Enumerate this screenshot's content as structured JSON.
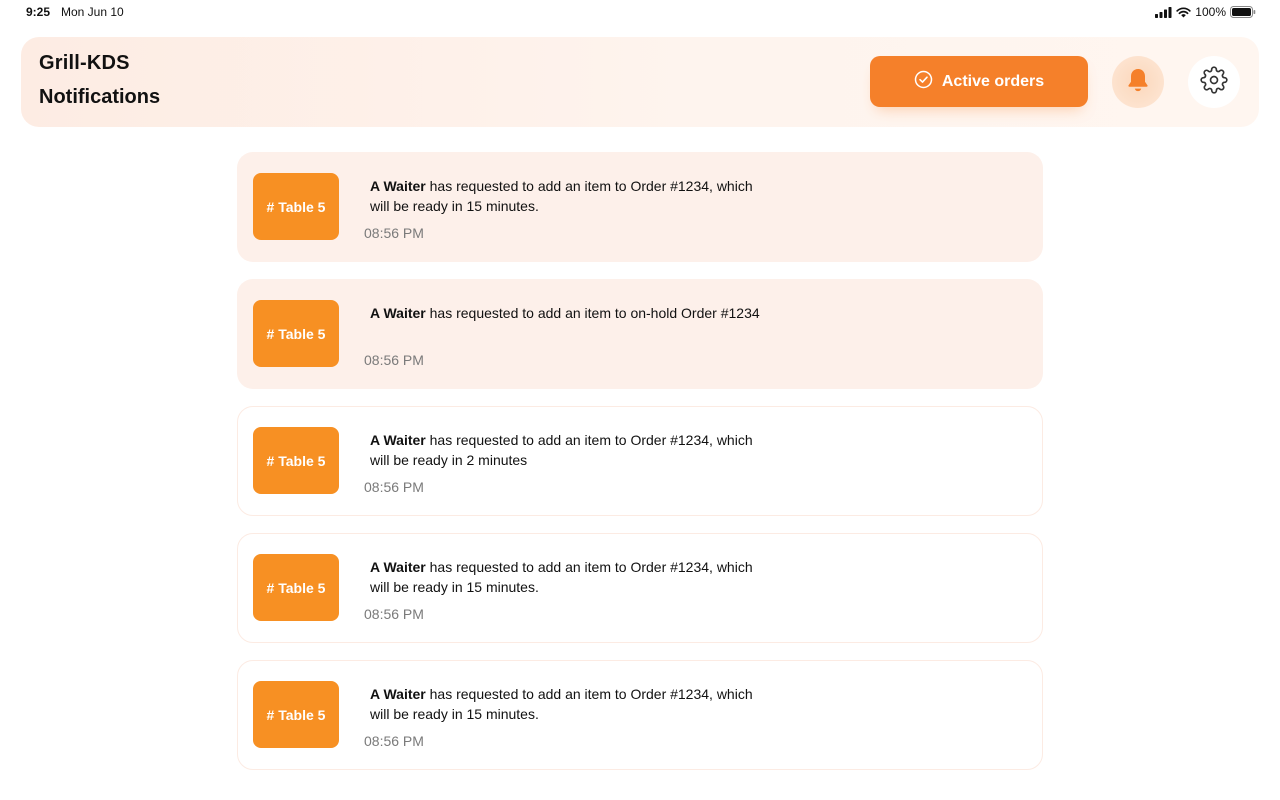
{
  "status_bar": {
    "time": "9:25",
    "date": "Mon Jun 10",
    "battery": "100%"
  },
  "header": {
    "app_title": "Grill-KDS",
    "page_title": "Notifications",
    "active_orders_label": "Active orders",
    "accent_color": "#f5802a"
  },
  "notifications": [
    {
      "badge": "# Table 5",
      "actor": "A Waiter",
      "message": " has requested to add an item to Order #1234, which will be ready in 15 minutes.",
      "time": "08:56 PM",
      "unread": true
    },
    {
      "badge": "# Table 5",
      "actor": "A Waiter",
      "message": " has requested to add an item to on-hold Order #1234",
      "time": "08:56 PM",
      "unread": true
    },
    {
      "badge": "# Table 5",
      "actor": "A Waiter",
      "message": " has requested to add an item to Order #1234, which will be ready in 2 minutes",
      "time": "08:56 PM",
      "unread": false
    },
    {
      "badge": "# Table 5",
      "actor": "A Waiter",
      "message": " has requested to add an item to Order #1234, which will be ready in 15 minutes.",
      "time": "08:56 PM",
      "unread": false
    },
    {
      "badge": "# Table 5",
      "actor": "A Waiter",
      "message": " has requested to add an item to Order #1234, which will be ready in 15 minutes.",
      "time": "08:56 PM",
      "unread": false
    }
  ]
}
